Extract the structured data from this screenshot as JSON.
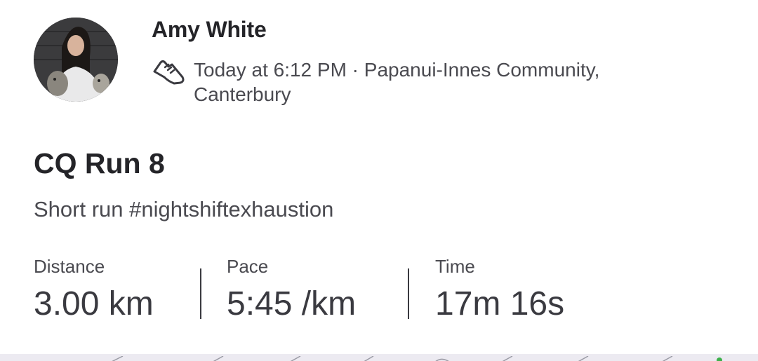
{
  "athlete": {
    "name": "Amy White",
    "avatar": "athlete-photo"
  },
  "activity": {
    "type_icon": "running-shoe-icon",
    "meta": "Today at 6:12 PM · Papanui-Innes Community, Canterbury",
    "title": "CQ Run 8",
    "description": "Short run #nightshiftexhaustion"
  },
  "stats": [
    {
      "label": "Distance",
      "value": "3.00 km"
    },
    {
      "label": "Pace",
      "value": "5:45 /km"
    },
    {
      "label": "Time",
      "value": "17m 16s"
    }
  ],
  "colors": {
    "text_primary": "#242428",
    "text_secondary": "#4a4a50",
    "background": "#ffffff",
    "map": "#eceaf1"
  }
}
